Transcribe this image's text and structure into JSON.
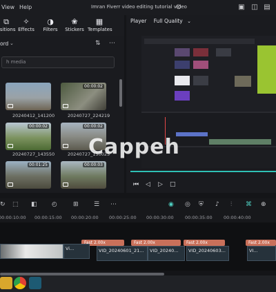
{
  "titlebar": {
    "menu": [
      "View",
      "Help"
    ],
    "window_title": "Imran Fiverr video editing tutorial video"
  },
  "toolbar": {
    "tools": [
      {
        "label": "ositions",
        "icon": "transitions-icon"
      },
      {
        "label": "Effects",
        "icon": "effects-icon"
      },
      {
        "label": "Filters",
        "icon": "filters-icon"
      },
      {
        "label": "Stickers",
        "icon": "stickers-icon"
      },
      {
        "label": "Templates",
        "icon": "templates-icon"
      }
    ]
  },
  "media": {
    "record_label": "ord",
    "search_placeholder": "h media",
    "clips": [
      {
        "name": "20240412_141200",
        "duration": ""
      },
      {
        "name": "20240727_224219",
        "duration": "00:00:02"
      },
      {
        "name": "20240727_143550",
        "duration": "00:00:02"
      },
      {
        "name": "20240727_150025",
        "duration": "00:00:02"
      },
      {
        "name": "",
        "duration": "00:01:25"
      },
      {
        "name": "",
        "duration": "00:00:03"
      }
    ]
  },
  "player": {
    "label": "Player",
    "quality": "Full Quality"
  },
  "timeline": {
    "ruler": [
      "00:00:10:00",
      "00:00:15:00",
      "00:00:20:00",
      "00:00:25:00",
      "00:00:30:00",
      "00:00:35:00",
      "00:00:40:00"
    ],
    "fast_labels": [
      "Fast 2.00x",
      "Fast 2.00x",
      "Fast 2.00x",
      "Fast 2.00x"
    ],
    "clips": [
      "Vi...",
      "VID_20240601_21...",
      "VID_20240...",
      "VID_20240603...",
      "VI..."
    ]
  },
  "watermark": "Cappeh",
  "colors": {
    "accent": "#2fc1b5",
    "fast_bar": "#c9705a",
    "bg": "#141518"
  }
}
